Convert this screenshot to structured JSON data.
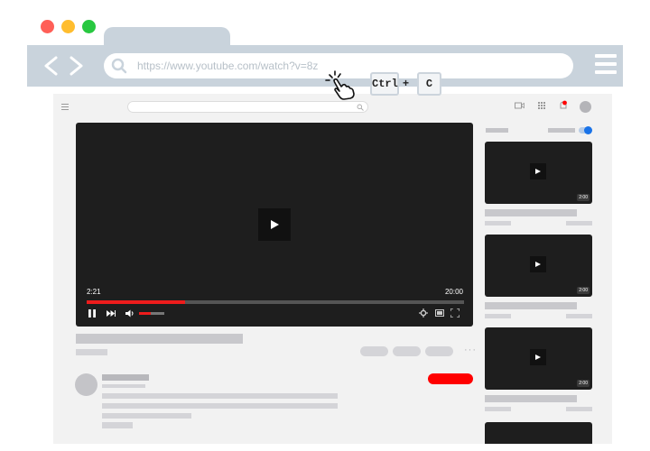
{
  "browser": {
    "url": "https://www.youtube.com/watch?v=8z",
    "traffic_lights": [
      "#ff5f57",
      "#ffbd2e",
      "#28c840"
    ],
    "chrome_color": "#c9d3dc"
  },
  "shortcut": {
    "key1": "Ctrl",
    "plus": "+",
    "key2": "C"
  },
  "player": {
    "current_time": "2:21",
    "total_time": "20:00",
    "progress_fraction": 0.26,
    "volume_fraction": 0.45,
    "accent": "#ee1c1c"
  },
  "sidebar": {
    "videos": [
      {
        "duration": "2:00"
      },
      {
        "duration": "2:00"
      },
      {
        "duration": "2:00"
      }
    ]
  },
  "colors": {
    "subscribe": "#ff0000",
    "notification": "#ff0000",
    "toggle": "#1a73e8"
  },
  "icons": [
    "search-icon",
    "menu-icon",
    "hand-tap-icon",
    "play-icon",
    "pause-icon",
    "next-icon",
    "volume-icon",
    "settings-icon",
    "miniplayer-icon",
    "fullscreen-icon",
    "camera-icon",
    "apps-icon",
    "bell-icon"
  ]
}
